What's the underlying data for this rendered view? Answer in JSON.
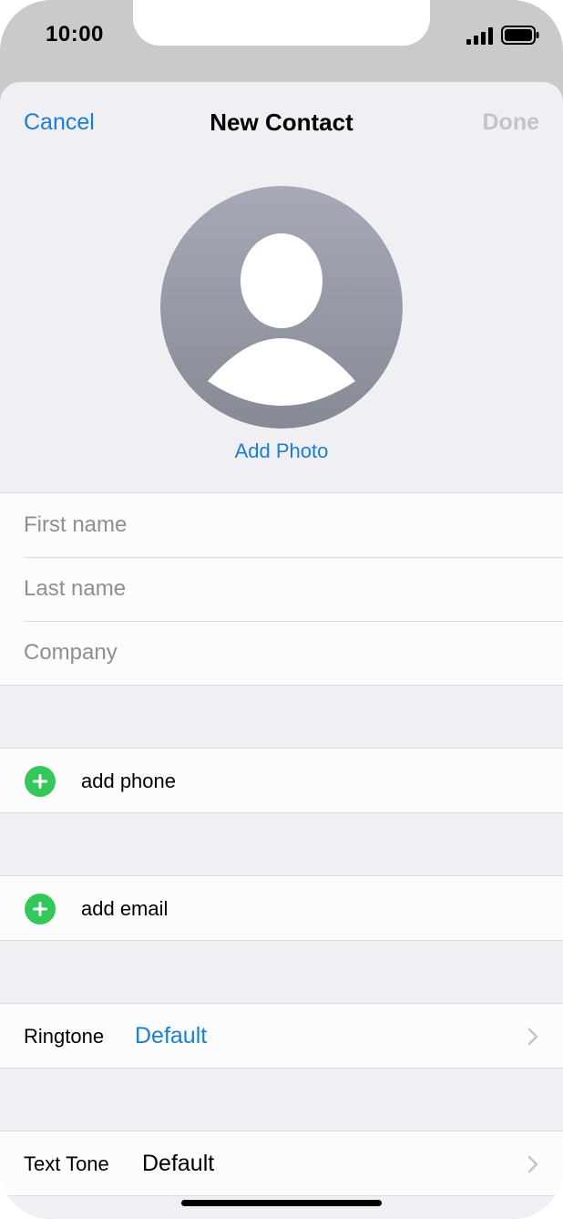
{
  "status_bar": {
    "time": "10:00",
    "signal_icon": "signal-bars-icon",
    "battery_icon": "battery-full-icon"
  },
  "nav": {
    "cancel_label": "Cancel",
    "title": "New Contact",
    "done_label": "Done"
  },
  "avatar": {
    "icon": "person-silhouette-icon",
    "add_photo_label": "Add Photo"
  },
  "name_fields": [
    {
      "placeholder": "First name",
      "value": ""
    },
    {
      "placeholder": "Last name",
      "value": ""
    },
    {
      "placeholder": "Company",
      "value": ""
    }
  ],
  "add_actions": [
    {
      "label": "add phone",
      "icon": "plus-circle-icon"
    },
    {
      "label": "add email",
      "icon": "plus-circle-icon"
    }
  ],
  "tones": [
    {
      "label": "Ringtone",
      "value": "Default",
      "value_color": "#1a7fd4"
    },
    {
      "label": "Text Tone",
      "value": "Default",
      "value_color": "#000000"
    }
  ],
  "colors": {
    "accent": "#1a7fd4",
    "add_green": "#34c759",
    "disabled": "#c4c4c7"
  }
}
